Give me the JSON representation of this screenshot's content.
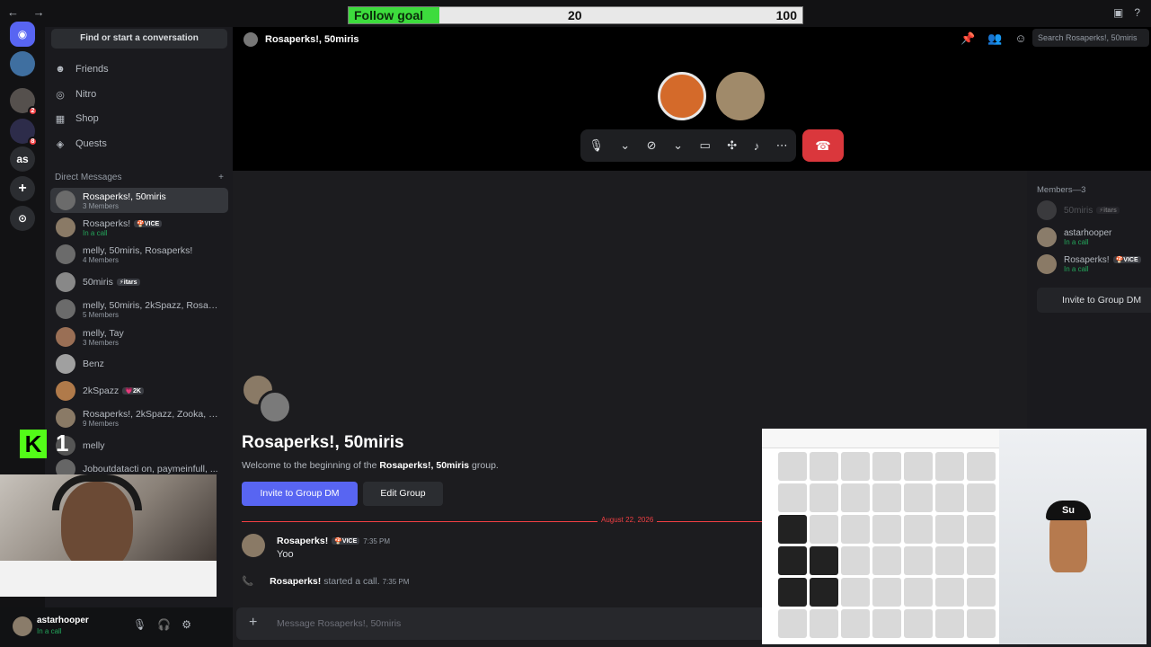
{
  "topbar": {
    "nav": "← →",
    "follow_goal": {
      "label": "Follow goal",
      "current": "20",
      "max": "100",
      "progress": 0.2
    },
    "icons": [
      "inbox-icon",
      "help-icon"
    ]
  },
  "rail": {
    "items": [
      {
        "name": "discord-home",
        "glyph": "◉"
      },
      {
        "name": "server-1",
        "glyph": ""
      },
      {
        "name": "server-2",
        "glyph": "",
        "badge": "2"
      },
      {
        "name": "server-3",
        "glyph": "",
        "badge": "8"
      },
      {
        "name": "server-as",
        "glyph": "as"
      },
      {
        "name": "add-server",
        "glyph": "+"
      },
      {
        "name": "discover",
        "glyph": "⊙"
      }
    ]
  },
  "sidebar": {
    "search_label": "Find or start a conversation",
    "nav": [
      {
        "label": "Friends",
        "icon": "friends-icon"
      },
      {
        "label": "Nitro",
        "icon": "nitro-icon"
      },
      {
        "label": "Shop",
        "icon": "shop-icon"
      },
      {
        "label": "Quests",
        "icon": "quests-icon"
      }
    ],
    "dm_header": "Direct Messages",
    "dm_add": "+",
    "dms": [
      {
        "name": "Rosaperks!, 50miris",
        "sub": "3 Members",
        "active": true
      },
      {
        "name": "Rosaperks!",
        "tag": "🍄VICE",
        "sub": "In a call",
        "call": true
      },
      {
        "name": "melly, 50miris, Rosaperks!",
        "sub": "4 Members"
      },
      {
        "name": "50miris",
        "tag": "⚡itars",
        "sub": ""
      },
      {
        "name": "melly, 50miris, 2kSpazz, Rosape...",
        "sub": "5 Members"
      },
      {
        "name": "melly, Tay",
        "sub": "3 Members"
      },
      {
        "name": "Benz",
        "sub": ""
      },
      {
        "name": "2kSpazz",
        "tag": "💗2K",
        "sub": ""
      },
      {
        "name": "Rosaperks!, 2kSpazz, Zooka, Ko...",
        "sub": "9 Members"
      },
      {
        "name": "melly",
        "sub": ""
      },
      {
        "name": "Joboutdatacti on, paymeinfull, ...",
        "sub": ""
      }
    ]
  },
  "user_panel": {
    "name": "astarhooper",
    "status": "In a call"
  },
  "overlay": {
    "kick_count": "1",
    "kick_letter": "K"
  },
  "call": {
    "title": "Rosaperks!, 50miris",
    "search_placeholder": "Search Rosaperks!, 50miris",
    "controls": [
      "mic-icon",
      "chevron-down-icon",
      "camera-off-icon",
      "chevron-down-icon",
      "screen-share-icon",
      "activities-icon",
      "soundboard-icon",
      "more-icon"
    ],
    "hangup": "☎"
  },
  "chat": {
    "title": "Rosaperks!, 50miris",
    "welcome_pre": "Welcome to the beginning of the ",
    "welcome_name": "Rosaperks!, 50miris",
    "welcome_post": " group.",
    "invite_button": "Invite to Group DM",
    "edit_button": "Edit Group",
    "date": "August 22, 2026",
    "message": {
      "author": "Rosaperks!",
      "tag": "🍄VICE",
      "time": "7:35 PM",
      "text": "Yoo"
    },
    "system": {
      "author": "Rosaperks!",
      "text": " started a call.",
      "time": "7:35 PM"
    },
    "composer_placeholder": "Message Rosaperks!, 50miris"
  },
  "members": {
    "header": "Members—3",
    "list": [
      {
        "name": "50miris",
        "tag": "⚡itars",
        "status": "",
        "idle": true
      },
      {
        "name": "astarhooper",
        "status": "In a call"
      },
      {
        "name": "Rosaperks!",
        "tag": "🍄VICE",
        "status": "In a call"
      }
    ],
    "invite": "Invite to Group DM"
  },
  "game": {
    "hat_text": "Su"
  }
}
